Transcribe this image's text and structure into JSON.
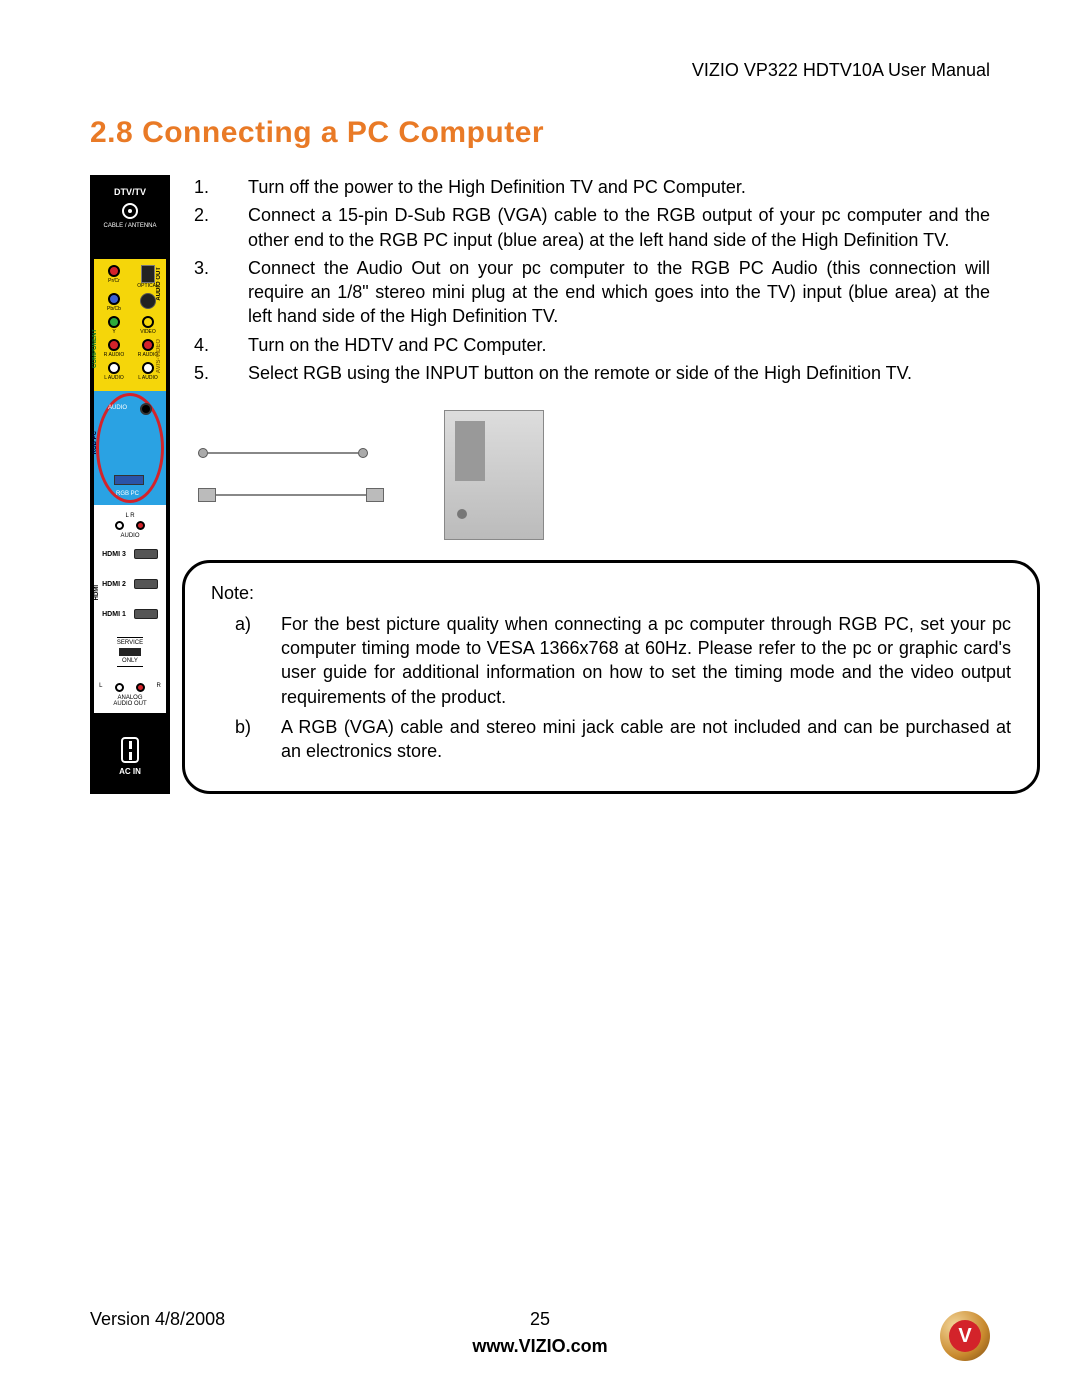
{
  "header": {
    "doc_title": "VIZIO VP322 HDTV10A User Manual"
  },
  "section": {
    "number": "2.8",
    "title": "Connecting a PC Computer"
  },
  "steps": [
    {
      "n": "1.",
      "text": "Turn off the power to the High Definition TV and PC Computer."
    },
    {
      "n": "2.",
      "text": "Connect a 15-pin D-Sub RGB (VGA) cable to the RGB output of your pc computer and the other end to the RGB PC input (blue area) at the left hand side of the High Definition TV."
    },
    {
      "n": "3.",
      "text": "Connect the Audio Out on your pc computer to the RGB PC Audio (this connection will require an 1/8\" stereo mini plug at the end which goes into the TV) input (blue area) at the left hand side of the High Definition TV."
    },
    {
      "n": "4.",
      "text": "Turn on the HDTV and PC Computer."
    },
    {
      "n": "5.",
      "text": "Select RGB using the INPUT button on the remote or side of the High Definition TV."
    }
  ],
  "note": {
    "title": "Note:",
    "items": [
      {
        "letter": "a)",
        "text": "For the best picture quality when connecting a pc computer through RGB PC, set your pc computer timing mode to VESA 1366x768 at 60Hz.  Please refer to the pc or graphic card's user guide for additional information on how to set the timing mode and the video output requirements of the product."
      },
      {
        "letter": "b)",
        "text": "A RGB (VGA) cable and stereo mini jack cable are not included and can be purchased at an electronics store."
      }
    ]
  },
  "panel": {
    "dtv_label": "DTV/TV",
    "cable_label": "CABLE / ANTENNA",
    "component_label": "COMPONENT",
    "audio_out_label": "AUDIO OUT",
    "av_label": "AV/S-VIDEO",
    "optical_label": "OPTICAL",
    "video_label": "VIDEO",
    "raudio_label": "R AUDIO",
    "laudio_label": "L AUDIO",
    "pr_label": "Pr/Cr",
    "pb_label": "Pb/Cb",
    "y_label": "Y",
    "rgb_zone_label": "RGB PC",
    "rgb_audio_label": "AUDIO",
    "rgb_port_label": "RGB PC",
    "hdmi_label": "HDMI",
    "hdmi3": "HDMI 3",
    "hdmi2": "HDMI 2",
    "hdmi1": "HDMI 1",
    "lr_audio": "L            R",
    "lr_audio2": "AUDIO",
    "service1": "SERVICE",
    "service2": "ONLY",
    "analog1": "ANALOG",
    "analog2": "AUDIO OUT",
    "acin": "AC IN"
  },
  "footer": {
    "version": "Version 4/8/2008",
    "page": "25",
    "url": "www.VIZIO.com",
    "logo_letter": "V"
  }
}
